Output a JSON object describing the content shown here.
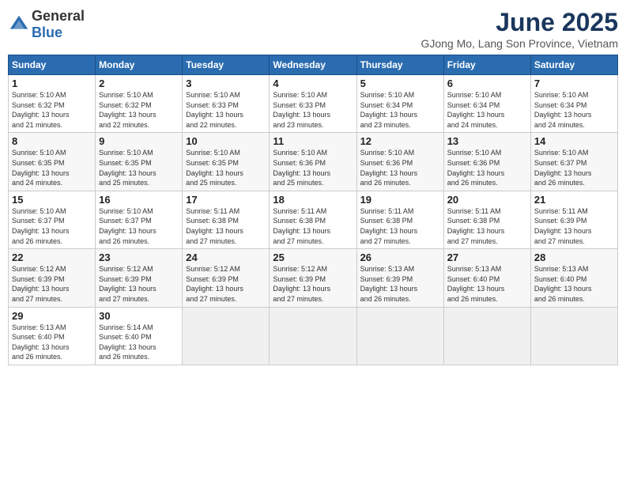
{
  "logo": {
    "general": "General",
    "blue": "Blue"
  },
  "title": "June 2025",
  "subtitle": "GJong Mo, Lang Son Province, Vietnam",
  "days_header": [
    "Sunday",
    "Monday",
    "Tuesday",
    "Wednesday",
    "Thursday",
    "Friday",
    "Saturday"
  ],
  "weeks": [
    [
      {
        "num": "1",
        "sunrise": "5:10 AM",
        "sunset": "6:32 PM",
        "daylight": "13 hours and 21 minutes."
      },
      {
        "num": "2",
        "sunrise": "5:10 AM",
        "sunset": "6:32 PM",
        "daylight": "13 hours and 22 minutes."
      },
      {
        "num": "3",
        "sunrise": "5:10 AM",
        "sunset": "6:33 PM",
        "daylight": "13 hours and 22 minutes."
      },
      {
        "num": "4",
        "sunrise": "5:10 AM",
        "sunset": "6:33 PM",
        "daylight": "13 hours and 23 minutes."
      },
      {
        "num": "5",
        "sunrise": "5:10 AM",
        "sunset": "6:34 PM",
        "daylight": "13 hours and 23 minutes."
      },
      {
        "num": "6",
        "sunrise": "5:10 AM",
        "sunset": "6:34 PM",
        "daylight": "13 hours and 24 minutes."
      },
      {
        "num": "7",
        "sunrise": "5:10 AM",
        "sunset": "6:34 PM",
        "daylight": "13 hours and 24 minutes."
      }
    ],
    [
      {
        "num": "8",
        "sunrise": "5:10 AM",
        "sunset": "6:35 PM",
        "daylight": "13 hours and 24 minutes."
      },
      {
        "num": "9",
        "sunrise": "5:10 AM",
        "sunset": "6:35 PM",
        "daylight": "13 hours and 25 minutes."
      },
      {
        "num": "10",
        "sunrise": "5:10 AM",
        "sunset": "6:35 PM",
        "daylight": "13 hours and 25 minutes."
      },
      {
        "num": "11",
        "sunrise": "5:10 AM",
        "sunset": "6:36 PM",
        "daylight": "13 hours and 25 minutes."
      },
      {
        "num": "12",
        "sunrise": "5:10 AM",
        "sunset": "6:36 PM",
        "daylight": "13 hours and 26 minutes."
      },
      {
        "num": "13",
        "sunrise": "5:10 AM",
        "sunset": "6:36 PM",
        "daylight": "13 hours and 26 minutes."
      },
      {
        "num": "14",
        "sunrise": "5:10 AM",
        "sunset": "6:37 PM",
        "daylight": "13 hours and 26 minutes."
      }
    ],
    [
      {
        "num": "15",
        "sunrise": "5:10 AM",
        "sunset": "6:37 PM",
        "daylight": "13 hours and 26 minutes."
      },
      {
        "num": "16",
        "sunrise": "5:10 AM",
        "sunset": "6:37 PM",
        "daylight": "13 hours and 26 minutes."
      },
      {
        "num": "17",
        "sunrise": "5:11 AM",
        "sunset": "6:38 PM",
        "daylight": "13 hours and 27 minutes."
      },
      {
        "num": "18",
        "sunrise": "5:11 AM",
        "sunset": "6:38 PM",
        "daylight": "13 hours and 27 minutes."
      },
      {
        "num": "19",
        "sunrise": "5:11 AM",
        "sunset": "6:38 PM",
        "daylight": "13 hours and 27 minutes."
      },
      {
        "num": "20",
        "sunrise": "5:11 AM",
        "sunset": "6:38 PM",
        "daylight": "13 hours and 27 minutes."
      },
      {
        "num": "21",
        "sunrise": "5:11 AM",
        "sunset": "6:39 PM",
        "daylight": "13 hours and 27 minutes."
      }
    ],
    [
      {
        "num": "22",
        "sunrise": "5:12 AM",
        "sunset": "6:39 PM",
        "daylight": "13 hours and 27 minutes."
      },
      {
        "num": "23",
        "sunrise": "5:12 AM",
        "sunset": "6:39 PM",
        "daylight": "13 hours and 27 minutes."
      },
      {
        "num": "24",
        "sunrise": "5:12 AM",
        "sunset": "6:39 PM",
        "daylight": "13 hours and 27 minutes."
      },
      {
        "num": "25",
        "sunrise": "5:12 AM",
        "sunset": "6:39 PM",
        "daylight": "13 hours and 27 minutes."
      },
      {
        "num": "26",
        "sunrise": "5:13 AM",
        "sunset": "6:39 PM",
        "daylight": "13 hours and 26 minutes."
      },
      {
        "num": "27",
        "sunrise": "5:13 AM",
        "sunset": "6:40 PM",
        "daylight": "13 hours and 26 minutes."
      },
      {
        "num": "28",
        "sunrise": "5:13 AM",
        "sunset": "6:40 PM",
        "daylight": "13 hours and 26 minutes."
      }
    ],
    [
      {
        "num": "29",
        "sunrise": "5:13 AM",
        "sunset": "6:40 PM",
        "daylight": "13 hours and 26 minutes."
      },
      {
        "num": "30",
        "sunrise": "5:14 AM",
        "sunset": "6:40 PM",
        "daylight": "13 hours and 26 minutes."
      },
      null,
      null,
      null,
      null,
      null
    ]
  ],
  "labels": {
    "sunrise": "Sunrise:",
    "sunset": "Sunset:",
    "daylight": "Daylight:"
  }
}
